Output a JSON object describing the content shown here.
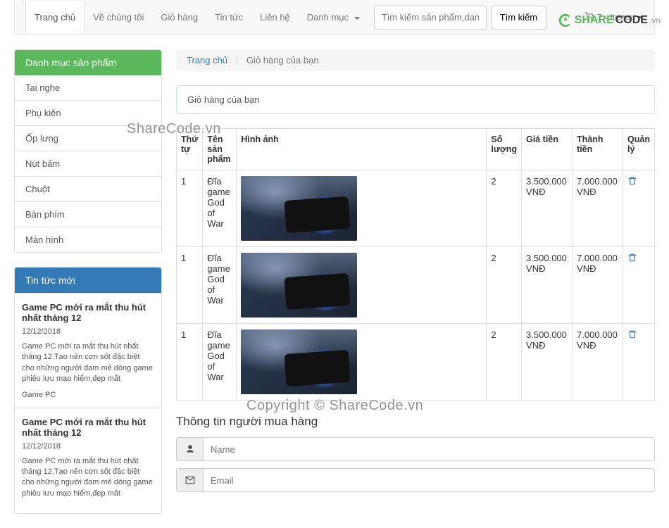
{
  "nav": {
    "items": [
      "Trang chủ",
      "Về chúng tôi",
      "Giỏ hàng",
      "Tin tức",
      "Liên hệ",
      "Danh mục"
    ],
    "active_index": 0
  },
  "search": {
    "placeholder": "Tìm kiếm sản phẩm,danh mục",
    "button": "Tìm kiếm"
  },
  "cart_link": "7 - Items",
  "logo": {
    "share": "SHARE",
    "code": "CODE",
    "vn": ".vn"
  },
  "sidebar": {
    "cat_title": "Danh mục sản phẩm",
    "categories": [
      "Tai nghe",
      "Phụ kiện",
      "Ốp lưng",
      "Nút bấm",
      "Chuột",
      "Bàn phím",
      "Màn hình"
    ],
    "news_title": "Tin tức mới",
    "news": [
      {
        "title": "Game PC mới ra mắt thu hút nhất tháng 12",
        "date": "12/12/2018",
        "excerpt": "Game PC mới ra mắt thu hút nhất tháng 12.Tạo nên cơn sốt đặc biệt cho những người đam mê dòng game phiêu lưu mạo hiểm,đẹp mắt",
        "cat": "Game PC"
      },
      {
        "title": "Game PC mới ra mắt thu hút nhất tháng 12",
        "date": "12/12/2018",
        "excerpt": "Game PC mới ra mắt thu hút nhất tháng 12.Tạo nên cơn sốt đặc biệt cho những người đam mê dòng game phiêu lưu mạo hiểm,đẹp mắt",
        "cat": ""
      }
    ]
  },
  "breadcrumb": {
    "home": "Trang chủ",
    "current": "Giỏ hàng của bạn"
  },
  "cart_title": "Giỏ hàng của bạn",
  "table": {
    "headers": {
      "idx": "Thứ tự",
      "name": "Tên sản phẩm",
      "image": "Hình ảnh",
      "qty": "Số lượng",
      "price": "Giá tiền",
      "total": "Thành tiền",
      "manage": "Quản lý"
    },
    "rows": [
      {
        "idx": "1",
        "name": "Đĩa game God of War",
        "qty": "2",
        "price": "3.500.000 VNĐ",
        "total": "7.000.000 VNĐ"
      },
      {
        "idx": "1",
        "name": "Đĩa game God of War",
        "qty": "2",
        "price": "3.500.000 VNĐ",
        "total": "7.000.000 VNĐ"
      },
      {
        "idx": "1",
        "name": "Đĩa game God of War",
        "qty": "2",
        "price": "3.500.000 VNĐ",
        "total": "7.000.000 VNĐ"
      }
    ]
  },
  "buyer_section": "Thông tin người mua hàng",
  "form": {
    "name_ph": "Name",
    "email_ph": "Email"
  },
  "watermark1": "ShareCode.vn",
  "watermark2": "Copyright © ShareCode.vn"
}
